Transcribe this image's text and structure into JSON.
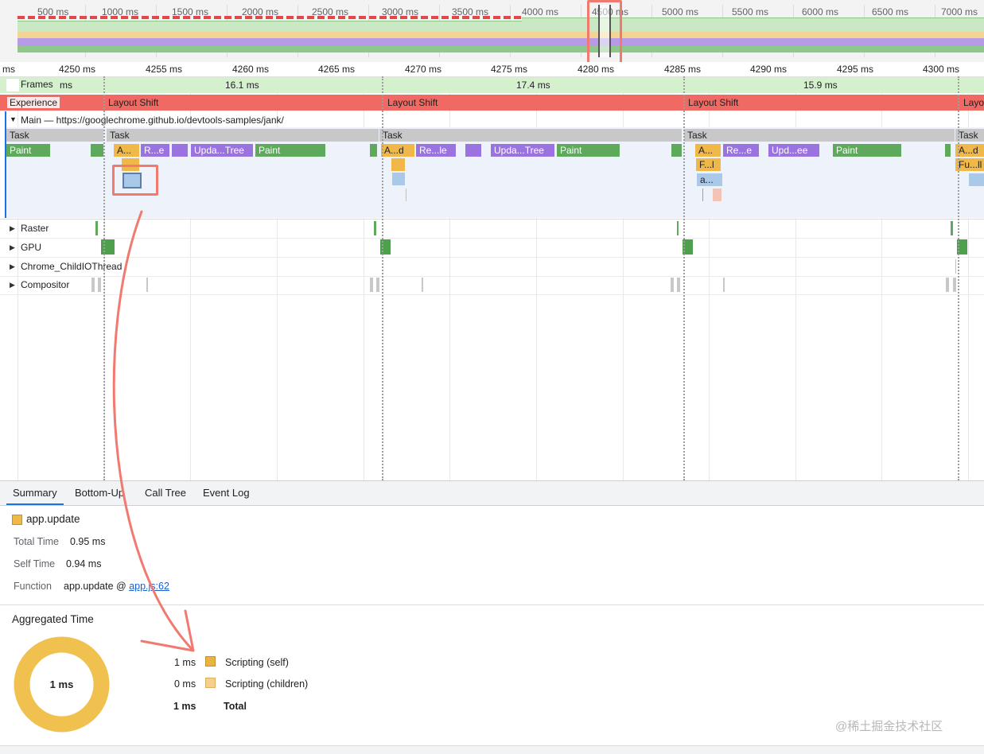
{
  "colors": {
    "scripting": "#f0b848",
    "scripting_children": "#f5d08a",
    "paint": "#5ea95c",
    "rendering": "#9a73e0",
    "layout_shift": "#f06a63",
    "frames": "#d4f0cd",
    "annotation": "#f07a70",
    "link": "#1a5fd1"
  },
  "overview": {
    "ticks": [
      "500 ms",
      "1000 ms",
      "1500 ms",
      "2000 ms",
      "2500 ms",
      "3000 ms",
      "3500 ms",
      "4000 ms",
      "4500 ms",
      "5000 ms",
      "5500 ms",
      "6000 ms",
      "6500 ms",
      "7000 ms"
    ]
  },
  "ruler": {
    "ticks": [
      "ms",
      "4250 ms",
      "4255 ms",
      "4260 ms",
      "4265 ms",
      "4270 ms",
      "4275 ms",
      "4280 ms",
      "4285 ms",
      "4290 ms",
      "4295 ms",
      "4300 ms"
    ]
  },
  "frames": {
    "label": "Frames",
    "items": [
      "ms",
      "16.1 ms",
      "17.4 ms",
      "15.9 ms"
    ]
  },
  "experience": {
    "label": "Experience",
    "items": [
      "Layout Shift",
      "Layout Shift",
      "Layout Shift",
      "Layo"
    ]
  },
  "main": {
    "title": "Main — https://googlechrome.github.io/devtools-samples/jank/",
    "task_label": "Task",
    "bars": {
      "paint": "Paint",
      "a_dots": "A...",
      "re_e": "R...e",
      "upda_tree": "Upda...Tree",
      "a_d": "A...d",
      "re_le": "Re...le",
      "f_l": "F...l",
      "re_e2": "Re...e",
      "upd_ee": "Upd...ee",
      "a_short": "a...",
      "fu_ll": "Fu...ll"
    }
  },
  "threads": [
    {
      "label": "Raster"
    },
    {
      "label": "GPU"
    },
    {
      "label": "Chrome_ChildIOThread"
    },
    {
      "label": "Compositor"
    }
  ],
  "tabs": [
    "Summary",
    "Bottom-Up",
    "Call Tree",
    "Event Log"
  ],
  "summary": {
    "title": "app.update",
    "total_time_label": "Total Time",
    "total_time": "0.95 ms",
    "self_time_label": "Self Time",
    "self_time": "0.94 ms",
    "function_label": "Function",
    "function_name": "app.update @ ",
    "function_link": "app.js:62"
  },
  "aggregated": {
    "title": "Aggregated Time",
    "donut_center": "1 ms",
    "rows": [
      {
        "value": "1 ms",
        "label": "Scripting (self)"
      },
      {
        "value": "0 ms",
        "label": "Scripting (children)"
      }
    ],
    "total_value": "1 ms",
    "total_label": "Total"
  },
  "watermark": "@稀土掘金技术社区"
}
